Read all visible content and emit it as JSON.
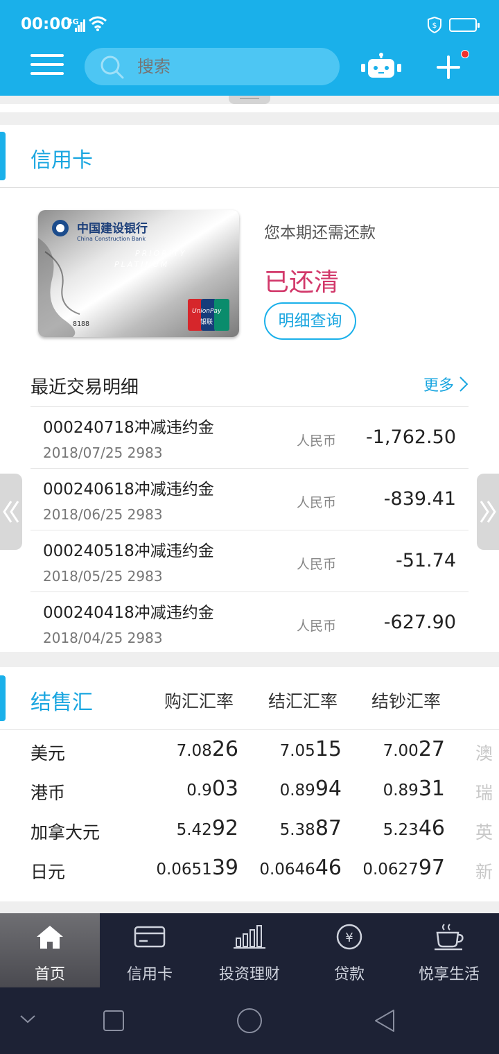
{
  "status_bar": {
    "time": "00:00",
    "network": "4G"
  },
  "header": {
    "search_placeholder": "搜索"
  },
  "credit_card": {
    "section_title": "信用卡",
    "due_label": "您本期还需还款",
    "due_status": "已还清",
    "detail_button": "明细查询",
    "card_image": {
      "bank_cn": "中国建设银行",
      "bank_en": "China Construction Bank",
      "tier_line1": "PRIORITY",
      "tier_line2": "PLATINUM",
      "number_fragment": "8188",
      "network_en": "UnionPay",
      "network_cn": "银联"
    },
    "recent_title": "最近交易明细",
    "more_label": "更多",
    "transactions": [
      {
        "name": "000240718冲减违约金",
        "date": "2018/07/25",
        "card": "2983",
        "currency": "人民币",
        "amount": "-1,762.50"
      },
      {
        "name": "000240618冲减违约金",
        "date": "2018/06/25",
        "card": "2983",
        "currency": "人民币",
        "amount": "-839.41"
      },
      {
        "name": "000240518冲减违约金",
        "date": "2018/05/25",
        "card": "2983",
        "currency": "人民币",
        "amount": "-51.74"
      },
      {
        "name": "000240418冲减违约金",
        "date": "2018/04/25",
        "card": "2983",
        "currency": "人民币",
        "amount": "-627.90"
      }
    ]
  },
  "fx": {
    "section_title": "结售汇",
    "columns": [
      "购汇汇率",
      "结汇汇率",
      "结钞汇率"
    ],
    "rows": [
      {
        "currency": "美元",
        "buy_small": "7.08",
        "buy_big": "26",
        "sell_small": "7.05",
        "sell_big": "15",
        "cash_small": "7.00",
        "cash_big": "27",
        "next": "澳"
      },
      {
        "currency": "港币",
        "buy_small": "0.9",
        "buy_big": "03",
        "sell_small": "0.89",
        "sell_big": "94",
        "cash_small": "0.89",
        "cash_big": "31",
        "next": "瑞"
      },
      {
        "currency": "加拿大元",
        "buy_small": "5.42",
        "buy_big": "92",
        "sell_small": "5.38",
        "sell_big": "87",
        "cash_small": "5.23",
        "cash_big": "46",
        "next": "英"
      },
      {
        "currency": "日元",
        "buy_small": "0.0651",
        "buy_big": "39",
        "sell_small": "0.0646",
        "sell_big": "46",
        "cash_small": "0.0627",
        "cash_big": "97",
        "next": "新"
      }
    ]
  },
  "bottom_nav": [
    {
      "label": "首页",
      "icon": "home-icon",
      "active": true
    },
    {
      "label": "信用卡",
      "icon": "credit-card-icon",
      "active": false
    },
    {
      "label": "投资理财",
      "icon": "bar-chart-icon",
      "active": false
    },
    {
      "label": "贷款",
      "icon": "yuan-coin-icon",
      "active": false
    },
    {
      "label": "悦享生活",
      "icon": "coffee-cup-icon",
      "active": false
    }
  ],
  "colors": {
    "primary": "#1ab0ea",
    "due_status": "#d2386a",
    "nav_bg": "#1d2235"
  }
}
